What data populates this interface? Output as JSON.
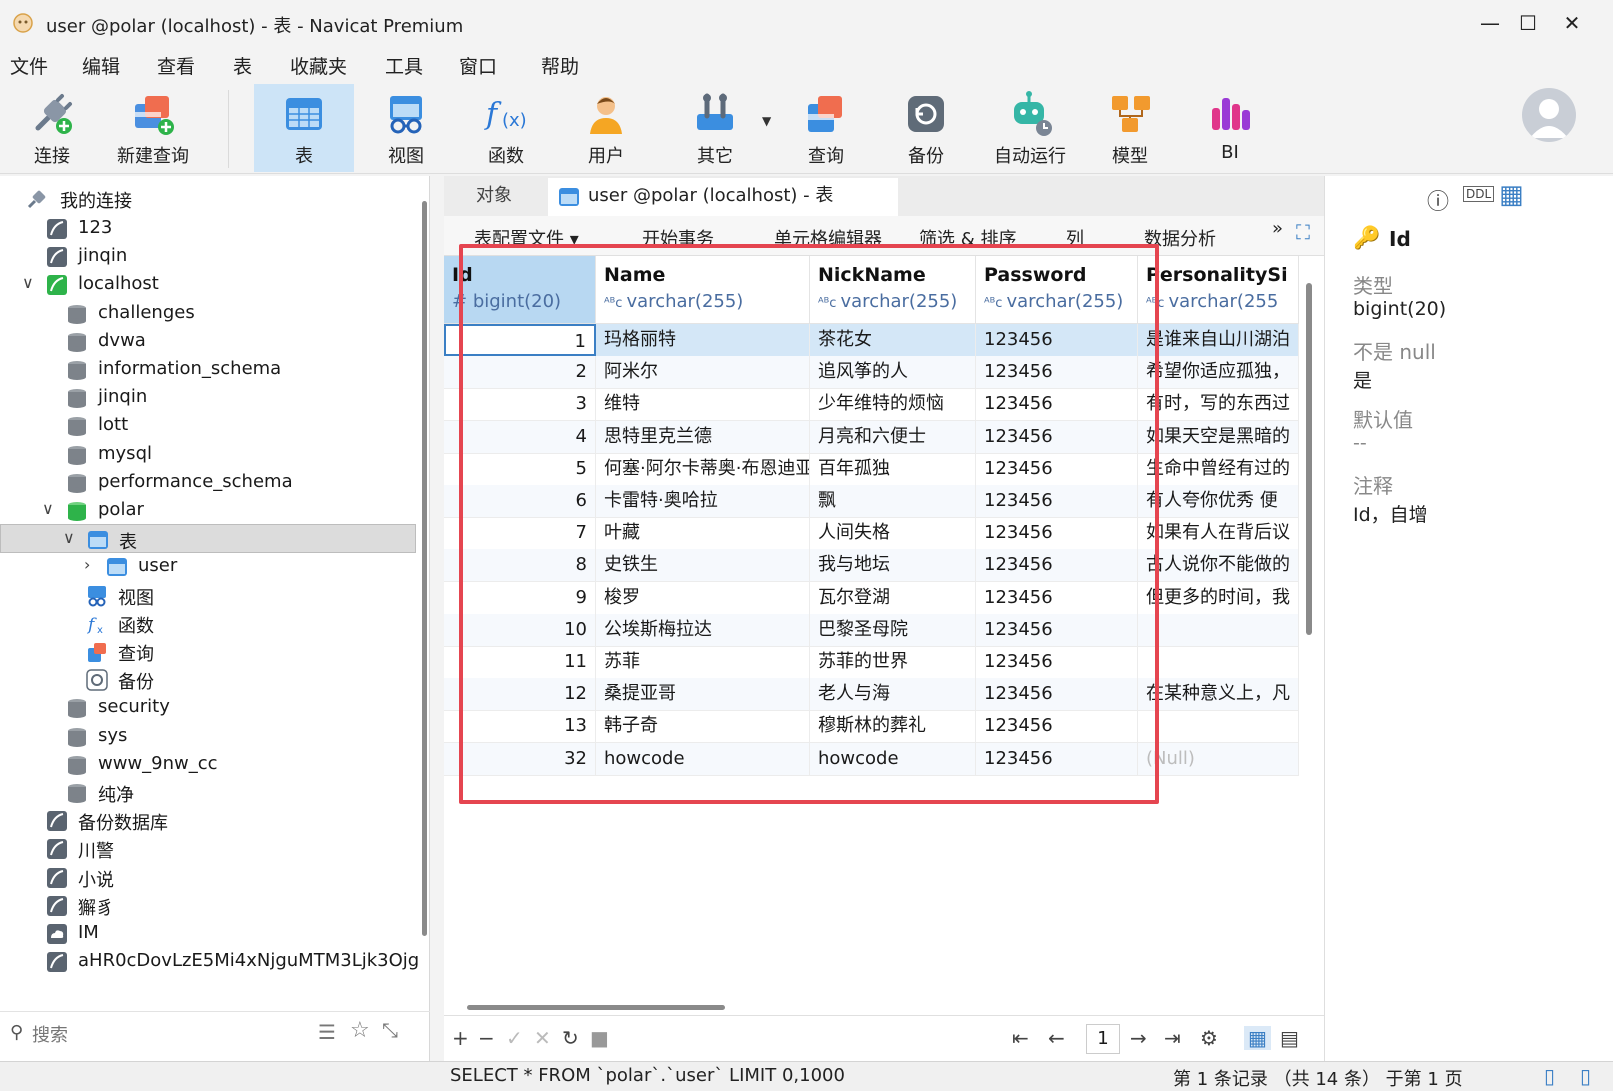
{
  "window": {
    "title": "user @polar (localhost) - 表 - Navicat Premium",
    "controls": {
      "minimize": "—",
      "maximize": "☐",
      "close": "✕"
    }
  },
  "menu": [
    "文件",
    "编辑",
    "查看",
    "表",
    "收藏夹",
    "工具",
    "窗口",
    "帮助"
  ],
  "toolbar": {
    "connect": "连接",
    "new_query": "新建查询",
    "table": "表",
    "view": "视图",
    "function": "函数",
    "user": "用户",
    "other": "其它",
    "query": "查询",
    "backup": "备份",
    "automation": "自动运行",
    "model": "模型",
    "bi": "BI"
  },
  "sidebar": {
    "root": "我的连接",
    "connections_top": [
      "123",
      "jinqin",
      "localhost"
    ],
    "localhost_dbs": [
      "challenges",
      "dvwa",
      "information_schema",
      "jinqin",
      "lott",
      "mysql",
      "performance_schema",
      "polar"
    ],
    "polar_children": {
      "tables": "表",
      "user_table": "user",
      "views": "视图",
      "functions": "函数",
      "queries": "查询",
      "backups": "备份"
    },
    "localhost_dbs_after": [
      "security",
      "sys",
      "www_9nw_cc",
      "纯净"
    ],
    "connections_bottom": [
      "备份数据库",
      "川警",
      "小说",
      "獬豸",
      "IM",
      "aHR0cDovLzE5Mi4xNjguMTM3Ljk3Ojg"
    ],
    "search_placeholder": "搜索"
  },
  "tabs": {
    "objects": "对象",
    "active": "user @polar (localhost) - 表"
  },
  "subtoolbar": [
    "表配置文件 ▾",
    "开始事务",
    "单元格编辑器",
    "筛选 & 排序",
    "列",
    "数据分析",
    "»"
  ],
  "grid": {
    "columns": [
      {
        "name": "Id",
        "type": "bigint(20)"
      },
      {
        "name": "Name",
        "type": "varchar(255)"
      },
      {
        "name": "NickName",
        "type": "varchar(255)"
      },
      {
        "name": "Password",
        "type": "varchar(255)"
      },
      {
        "name": "PersonalitySi",
        "type": "varchar(255"
      }
    ],
    "rows": [
      [
        "1",
        "玛格丽特",
        "茶花女",
        "123456",
        "是谁来自山川湖泊"
      ],
      [
        "2",
        "阿米尔",
        "追风筝的人",
        "123456",
        "希望你适应孤独，"
      ],
      [
        "3",
        "维特",
        "少年维特的烦恼",
        "123456",
        "有时，写的东西过"
      ],
      [
        "4",
        "思特里克兰德",
        "月亮和六便士",
        "123456",
        "如果天空是黑暗的"
      ],
      [
        "5",
        "何塞·阿尔卡蒂奥·布恩迪亚",
        "百年孤独",
        "123456",
        "生命中曾经有过的"
      ],
      [
        "6",
        "卡雷特·奥哈拉",
        "飘",
        "123456",
        "有人夸你优秀 便"
      ],
      [
        "7",
        "叶藏",
        "人间失格",
        "123456",
        "如果有人在背后议"
      ],
      [
        "8",
        "史铁生",
        "我与地坛",
        "123456",
        "古人说你不能做的"
      ],
      [
        "9",
        "梭罗",
        "瓦尔登湖",
        "123456",
        "但更多的时间，我"
      ],
      [
        "10",
        "公埃斯梅拉达",
        "巴黎圣母院",
        "123456",
        ""
      ],
      [
        "11",
        "苏菲",
        "苏菲的世界",
        "123456",
        ""
      ],
      [
        "12",
        "桑提亚哥",
        "老人与海",
        "123456",
        "在某种意义上，凡"
      ],
      [
        "13",
        "韩子奇",
        "穆斯林的葬礼",
        "123456",
        ""
      ],
      [
        "32",
        "howcode",
        "howcode",
        "123456",
        "(Null)"
      ]
    ]
  },
  "pagination": {
    "page": "1"
  },
  "rightpane": {
    "field_name": "Id",
    "type_label": "类型",
    "type_value": "bigint(20)",
    "notnull_label": "不是 null",
    "notnull_value": "是",
    "default_label": "默认值",
    "default_value": "--",
    "comment_label": "注释",
    "comment_value": "Id，自增"
  },
  "status": {
    "sql": "SELECT * FROM `polar`.`user` LIMIT 0,1000",
    "records": "第 1 条记录 （共 14 条） 于第 1 页"
  },
  "colors": {
    "accent": "#3b7fc4",
    "selection": "#cde4f7",
    "highlight_box": "#e54550"
  }
}
